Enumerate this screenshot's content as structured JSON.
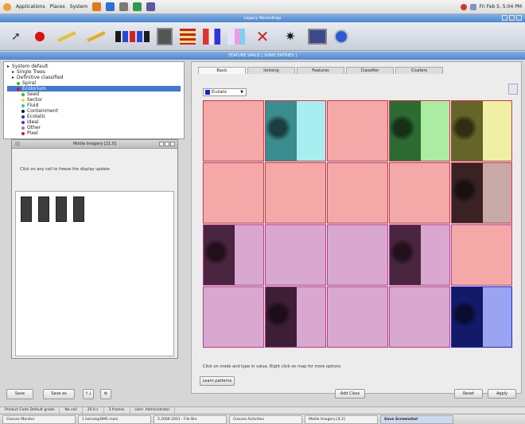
{
  "top_panel": {
    "menus": [
      "Applications",
      "Places",
      "System"
    ],
    "clock": "Fri Feb 5, 5:04 PM"
  },
  "app_title": "Legacy Recordings",
  "inner_title": "FEATURE SPACE  [ SOME ENTRIES ]",
  "toolbar": {
    "icons": [
      "arrow-cursor-icon",
      "pin-marker-icon",
      "wand-icon",
      "pen-icon",
      "blocks-icon",
      "dark-panel-icon",
      "striped-lines-icon",
      "color-columns-icon",
      "palette-icon",
      "cross-scissors-icon",
      "sparkle-icon",
      "image-frame-icon",
      "round-globe-icon"
    ]
  },
  "tree": {
    "rows": [
      {
        "label": "System default",
        "indent": 0,
        "dot": ""
      },
      {
        "label": "Single Trees",
        "indent": 1,
        "dot": ""
      },
      {
        "label": "Definitive classified",
        "indent": 1,
        "dot": ""
      },
      {
        "label": "Spiral",
        "indent": 2,
        "dot": "#22c322"
      },
      {
        "label": "Ecolorium",
        "indent": 2,
        "dot": "#d31818",
        "selected": true
      },
      {
        "label": "Seed",
        "indent": 3,
        "dot": "#2dbf2d"
      },
      {
        "label": "Sector",
        "indent": 3,
        "dot": "#e8e020"
      },
      {
        "label": "Fluid",
        "indent": 3,
        "dot": "#20c8d8"
      },
      {
        "label": "Containment",
        "indent": 3,
        "dot": "#111111"
      },
      {
        "label": "Ecolatic",
        "indent": 3,
        "dot": "#1a33d4"
      },
      {
        "label": "Ideal",
        "indent": 3,
        "dot": "#8a18c8"
      },
      {
        "label": "Other",
        "indent": 3,
        "dot": "#888888"
      },
      {
        "label": "Pixel",
        "indent": 3,
        "dot": "#e01818"
      }
    ]
  },
  "dialog": {
    "title": "Motile Imagery [21.0]",
    "message": "Click on any cell to freeze the display update"
  },
  "left_buttons": {
    "save": "Save",
    "save_as": "Save as",
    "up": "↑↓",
    "settings": "⚙"
  },
  "tabs": [
    "Basic",
    "Ionising",
    "Features",
    "Classifier",
    "Clusters"
  ],
  "class_select": {
    "value": "Ecolatic"
  },
  "grid": {
    "rows": [
      [
        {
          "tint": "#f4a8a8",
          "img": null
        },
        {
          "tint": "#a8eef0",
          "img": "#3b8c8e"
        },
        {
          "tint": "#f4a8a8",
          "img": null
        },
        {
          "tint": "#a9eca2",
          "img": "#2c6b32"
        },
        {
          "tint": "#efefa6",
          "img": "#65652a"
        }
      ],
      [
        {
          "tint": "#f4a8a8",
          "img": null
        },
        {
          "tint": "#f4a8a8",
          "img": null
        },
        {
          "tint": "#f4a8a8",
          "img": null
        },
        {
          "tint": "#f4a8a8",
          "img": null
        },
        {
          "tint": "#c9a8a8",
          "img": "#3a2224"
        }
      ],
      [
        {
          "tint": "#d8a8d0",
          "img": "#4a2540"
        },
        {
          "tint": "#d8a8d0",
          "img": null
        },
        {
          "tint": "#d8a8d0",
          "img": null
        },
        {
          "tint": "#d8a8d0",
          "img": "#4a2540"
        },
        {
          "tint": "#f4a8a8",
          "img": null
        }
      ],
      [
        {
          "tint": "#d8a8d0",
          "img": null
        },
        {
          "tint": "#d8a8d0",
          "img": "#3e1e36"
        },
        {
          "tint": "#d8a8d0",
          "img": null
        },
        {
          "tint": "#d8a8d0",
          "img": null
        },
        {
          "tint": "#9aa4f0",
          "img": "#141a6a"
        }
      ]
    ]
  },
  "right_hint": "Click on mode and type in value. Right click on map for more options",
  "right_buttons": {
    "learn": "Learn patterns",
    "add_class": "Add Class",
    "reset": "Reset",
    "apply": "Apply"
  },
  "status": [
    "Product Code Default grade",
    "No cell",
    "20.0 s",
    "3 frames",
    "User: Administrator"
  ],
  "taskbar": [
    {
      "label": "Classes Monitor",
      "active": false
    },
    {
      "label": "1 kernel@DMS main",
      "active": false
    },
    {
      "label": "2.2008 2001 - File Bro",
      "active": false
    },
    {
      "label": "Classes Activities",
      "active": false
    },
    {
      "label": "Motile Imagery [4.2]",
      "active": false
    },
    {
      "label": "Save Screenshot",
      "active": true
    }
  ]
}
